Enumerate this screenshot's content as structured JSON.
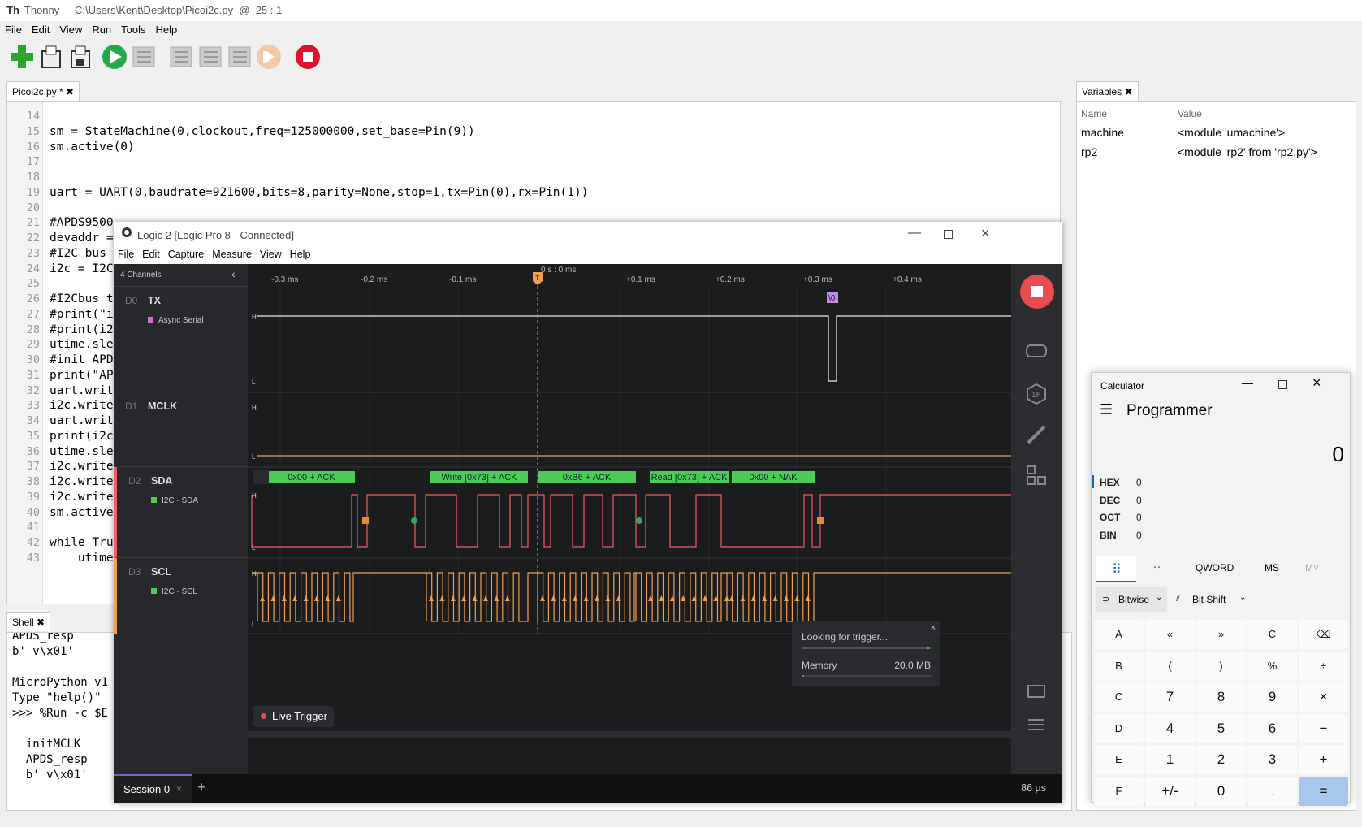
{
  "thonny": {
    "title": "Thonny  -  C:\\Users\\Kent\\Desktop\\Picoi2c.py  @  25 : 1",
    "menu": [
      "File",
      "Edit",
      "View",
      "Run",
      "Tools",
      "Help"
    ],
    "editor_tab": "Picoi2c.py *",
    "shell_tab": "Shell",
    "vars_tab": "Variables",
    "vars_header": {
      "name": "Name",
      "value": "Value"
    },
    "vars": [
      {
        "name": "machine",
        "value": "<module 'umachine'>"
      },
      {
        "name": "rp2",
        "value": "<module 'rp2' from 'rp2.py'>"
      }
    ],
    "lines": [
      {
        "n": "14",
        "t": ""
      },
      {
        "n": "15",
        "t": "sm = StateMachine(0,clockout,freq=125000000,set_base=Pin(9))"
      },
      {
        "n": "16",
        "t": "sm.active(0)"
      },
      {
        "n": "17",
        "t": ""
      },
      {
        "n": "18",
        "t": ""
      },
      {
        "n": "19",
        "t": "uart = UART(0,baudrate=921600,bits=8,parity=None,stop=1,tx=Pin(0),rx=Pin(1))"
      },
      {
        "n": "20",
        "t": ""
      },
      {
        "n": "21",
        "t": "#APDS9500"
      },
      {
        "n": "22",
        "t": "devaddr ="
      },
      {
        "n": "23",
        "t": "#I2C bus"
      },
      {
        "n": "24",
        "t": "i2c = I2C"
      },
      {
        "n": "25",
        "t": ""
      },
      {
        "n": "26",
        "t": "#I2Cbus t"
      },
      {
        "n": "27",
        "t": "#print(\"i"
      },
      {
        "n": "28",
        "t": "#print(i2"
      },
      {
        "n": "29",
        "t": "utime.sle"
      },
      {
        "n": "30",
        "t": "#init APD"
      },
      {
        "n": "31",
        "t": "print(\"AP"
      },
      {
        "n": "32",
        "t": "uart.writ"
      },
      {
        "n": "33",
        "t": "i2c.write"
      },
      {
        "n": "34",
        "t": "uart.writ"
      },
      {
        "n": "35",
        "t": "print(i2c"
      },
      {
        "n": "36",
        "t": "utime.sle"
      },
      {
        "n": "37",
        "t": "i2c.write"
      },
      {
        "n": "38",
        "t": "i2c.write"
      },
      {
        "n": "39",
        "t": "i2c.write"
      },
      {
        "n": "40",
        "t": "sm.active"
      },
      {
        "n": "41",
        "t": ""
      },
      {
        "n": "42",
        "t": "while Tru"
      },
      {
        "n": "43",
        "t": "    utime"
      }
    ],
    "shell_lines": [
      "APDS_resp",
      "b' v\\x01'",
      "",
      "MicroPython v1",
      "Type \"help()\"",
      ">>> %Run -c $E",
      "",
      "  initMCLK",
      "  APDS_resp",
      "  b' v\\x01'"
    ]
  },
  "logic": {
    "title": "Logic 2 [Logic Pro 8 - Connected]",
    "menu": [
      "File",
      "Edit",
      "Capture",
      "Measure",
      "View",
      "Help"
    ],
    "channels_label": "4 Channels",
    "time_ticks": [
      "-0.3 ms",
      "-0.2 ms",
      "-0.1 ms",
      "0 s : 0 ms",
      "+0.1 ms",
      "+0.2 ms",
      "+0.3 ms",
      "+0.4 ms"
    ],
    "channels": [
      {
        "id": "D0",
        "name": "TX",
        "analyzer": "Async Serial"
      },
      {
        "id": "D1",
        "name": "MCLK",
        "analyzer": ""
      },
      {
        "id": "D2",
        "name": "SDA",
        "analyzer": "I2C - SDA"
      },
      {
        "id": "D3",
        "name": "SCL",
        "analyzer": "I2C - SCL"
      }
    ],
    "tx_decode": "\\0",
    "i2c_frames": [
      "0x00 + ACK",
      "Write [0x73] + ACK",
      "0xB6 + ACK",
      "Read [0x73] + ACK",
      "0x00 + NAK"
    ],
    "trigger_status": "Looking for trigger...",
    "memory_label": "Memory",
    "memory_value": "20.0 MB",
    "memory_used": 0.02,
    "trigger_progress": 0.98,
    "live_trigger": "Live Trigger",
    "session": "Session 0",
    "zoom": "86 µs",
    "hl": {
      "H": "H",
      "L": "L"
    },
    "trigger_marker": "T"
  },
  "calc": {
    "title": "Calculator",
    "mode": "Programmer",
    "display": "0",
    "radix": [
      {
        "k": "HEX",
        "v": "0"
      },
      {
        "k": "DEC",
        "v": "0"
      },
      {
        "k": "OCT",
        "v": "0"
      },
      {
        "k": "BIN",
        "v": "0"
      }
    ],
    "word": "QWORD",
    "ms": "MS",
    "mplus": "M˅",
    "bitwise": "Bitwise",
    "bitshift": "Bit Shift",
    "keys": [
      [
        "A",
        "«",
        "»",
        "C",
        "⌫"
      ],
      [
        "B",
        "(",
        ")",
        "%",
        "÷"
      ],
      [
        "C",
        "7",
        "8",
        "9",
        "×"
      ],
      [
        "D",
        "4",
        "5",
        "6",
        "−"
      ],
      [
        "E",
        "1",
        "2",
        "3",
        "+"
      ],
      [
        "F",
        "+/-",
        "0",
        ".",
        "="
      ]
    ]
  }
}
